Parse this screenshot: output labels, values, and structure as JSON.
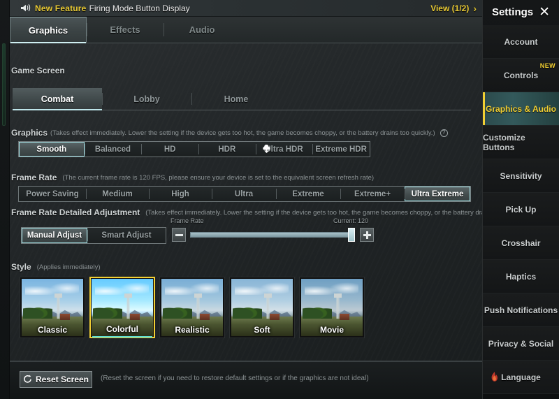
{
  "banner": {
    "icon": "speaker-icon",
    "new_label": "New Feature",
    "text": "Firing Mode Button Display",
    "view_label": "View (1/2)",
    "chevron": "›"
  },
  "tabs": [
    {
      "label": "Graphics",
      "active": true
    },
    {
      "label": "Effects",
      "active": false
    },
    {
      "label": "Audio",
      "active": false
    }
  ],
  "game_screen": {
    "title": "Game Screen",
    "options": [
      {
        "label": "Combat",
        "active": true
      },
      {
        "label": "Lobby",
        "active": false
      },
      {
        "label": "Home",
        "active": false
      }
    ]
  },
  "graphics": {
    "label": "Graphics",
    "note": "(Takes effect immediately. Lower the setting if the device gets too hot, the game becomes choppy, or the battery drains too quickly.)",
    "help_icon": "question-mark-icon",
    "options": [
      {
        "label": "Smooth",
        "active": true,
        "icon": null
      },
      {
        "label": "Balanced",
        "active": false,
        "icon": null
      },
      {
        "label": "HD",
        "active": false,
        "icon": null
      },
      {
        "label": "HDR",
        "active": false,
        "icon": null
      },
      {
        "label": "Ultra HDR",
        "active": false,
        "icon": "cloud-download-icon"
      },
      {
        "label": "Extreme HDR",
        "active": false,
        "icon": null
      }
    ]
  },
  "frame_rate": {
    "label": "Frame Rate",
    "note": "(The current frame rate is 120 FPS, please ensure your device is set to the equivalent screen refresh rate)",
    "options": [
      {
        "label": "Power Saving",
        "active": false
      },
      {
        "label": "Medium",
        "active": false
      },
      {
        "label": "High",
        "active": false
      },
      {
        "label": "Ultra",
        "active": false
      },
      {
        "label": "Extreme",
        "active": false
      },
      {
        "label": "Extreme+",
        "active": false
      },
      {
        "label": "Ultra Extreme",
        "active": true
      }
    ]
  },
  "frame_rate_detailed": {
    "label": "Frame Rate Detailed Adjustment",
    "note": "(Takes effect immediately. Lower the setting if the device gets too hot, the game becomes choppy, or the battery drains too",
    "modes": [
      {
        "label": "Manual Adjust",
        "active": true
      },
      {
        "label": "Smart Adjust",
        "active": false
      }
    ],
    "slider_label": "Frame Rate",
    "current_label": "Current: 120",
    "current_value": 120,
    "slider_percent": 100,
    "decrease_icon": "minus-icon",
    "increase_icon": "plus-icon"
  },
  "style": {
    "label": "Style",
    "note": "(Applies immediately)",
    "items": [
      {
        "label": "Classic",
        "active": false
      },
      {
        "label": "Colorful",
        "active": true
      },
      {
        "label": "Realistic",
        "active": false
      },
      {
        "label": "Soft",
        "active": false
      },
      {
        "label": "Movie",
        "active": false
      }
    ]
  },
  "bottom": {
    "reset_icon": "reset-arrow-icon",
    "reset_label": "Reset Screen",
    "reset_note": "(Reset the screen if you need to restore default settings or if the graphics are not ideal)"
  },
  "sidebar": {
    "title": "Settings",
    "close_icon": "close-icon",
    "items": [
      {
        "label": "Account",
        "active": false,
        "badge": null,
        "icon": null
      },
      {
        "label": "Controls",
        "active": false,
        "badge": "NEW",
        "icon": null
      },
      {
        "label": "Graphics & Audio",
        "active": true,
        "badge": null,
        "icon": null
      },
      {
        "label": "Customize Buttons",
        "active": false,
        "badge": null,
        "icon": null
      },
      {
        "label": "Sensitivity",
        "active": false,
        "badge": null,
        "icon": null
      },
      {
        "label": "Pick Up",
        "active": false,
        "badge": null,
        "icon": null
      },
      {
        "label": "Crosshair",
        "active": false,
        "badge": null,
        "icon": null
      },
      {
        "label": "Haptics",
        "active": false,
        "badge": null,
        "icon": null
      },
      {
        "label": "Push Notifications",
        "active": false,
        "badge": null,
        "icon": null
      },
      {
        "label": "Privacy & Social",
        "active": false,
        "badge": null,
        "icon": null
      },
      {
        "label": "Language",
        "active": false,
        "badge": null,
        "icon": "flame-icon"
      }
    ]
  },
  "colors": {
    "accent_yellow": "#f1cf33",
    "accent_cyan": "#a6e4e8",
    "panel_bg": "#23282a",
    "sidebar_bg": "#151718"
  }
}
